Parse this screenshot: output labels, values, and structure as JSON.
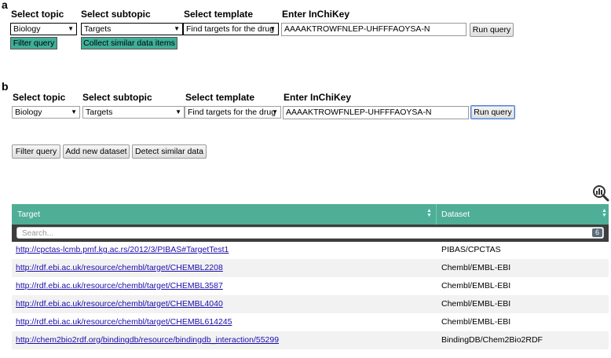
{
  "panel_a": {
    "letter": "a",
    "headers": {
      "topic": "Select topic",
      "subtopic": "Select subtopic",
      "template": "Select template",
      "inchikey": "Enter InChiKey"
    },
    "topic_value": "Biology",
    "subtopic_value": "Targets",
    "template_value": "Find targets for the drug",
    "inchikey_value": "AAAAKTROWFNLEP-UHFFFAOYSA-N",
    "run_query": "Run query",
    "filter_query": "Filter query",
    "collect_similar": "Collect similar data items"
  },
  "panel_b": {
    "letter": "b",
    "headers": {
      "topic": "Select topic",
      "subtopic": "Select subtopic",
      "template": "Select template",
      "inchikey": "Enter InChiKey"
    },
    "topic_value": "Biology",
    "subtopic_value": "Targets",
    "template_value": "Find targets for the drug",
    "inchikey_value": "AAAAKTROWFNLEP-UHFFFAOYSA-N",
    "run_query": "Run query",
    "filter_query": "Filter query",
    "add_dataset": "Add new dataset",
    "detect_similar": "Detect similar data"
  },
  "table": {
    "columns": [
      "Target",
      "Dataset"
    ],
    "search_placeholder": "Search...",
    "count": "6",
    "rows": [
      {
        "target": "http://cpctas-lcmb.pmf.kg.ac.rs/2012/3/PIBAS#TargetTest1",
        "dataset": "PIBAS/CPCTAS"
      },
      {
        "target": "http://rdf.ebi.ac.uk/resource/chembl/target/CHEMBL2208",
        "dataset": "Chembl/EMBL-EBI"
      },
      {
        "target": "http://rdf.ebi.ac.uk/resource/chembl/target/CHEMBL3587",
        "dataset": "Chembl/EMBL-EBI"
      },
      {
        "target": "http://rdf.ebi.ac.uk/resource/chembl/target/CHEMBL4040",
        "dataset": "Chembl/EMBL-EBI"
      },
      {
        "target": "http://rdf.ebi.ac.uk/resource/chembl/target/CHEMBL614245",
        "dataset": "Chembl/EMBL-EBI"
      },
      {
        "target": "http://chem2bio2rdf.org/bindingdb/resource/bindingdb_interaction/55299",
        "dataset": "BindingDB/Chem2Bio2RDF"
      }
    ]
  },
  "icons": {
    "analytics": "chart-magnifier-icon"
  }
}
